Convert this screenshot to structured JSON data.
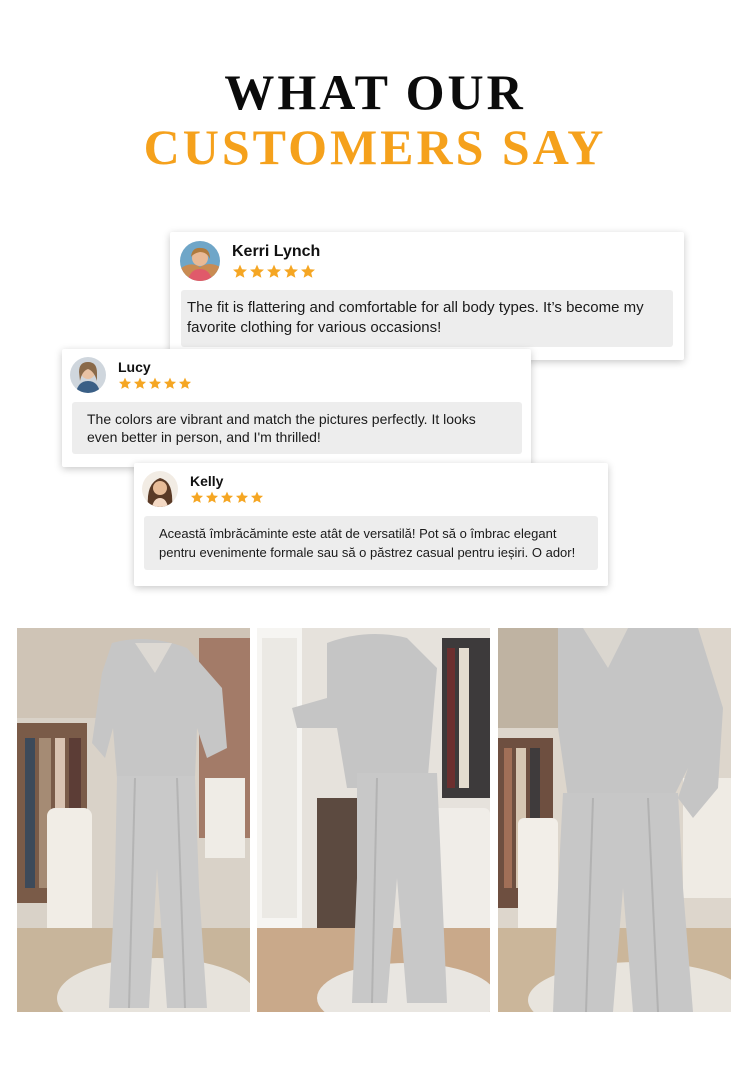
{
  "heading": {
    "line1": "WHAT OUR",
    "line2": "CUSTOMERS SAY",
    "line1_color": "#0b0b0b",
    "accent_color": "#f5a11c"
  },
  "reviews": [
    {
      "name": "Kerri Lynch",
      "rating": 5,
      "text": "The fit is flattering and comfortable for all body types. It’s become my favorite clothing for various occasions!",
      "avatar_icon": "customer-avatar"
    },
    {
      "name": "Lucy",
      "rating": 5,
      "text": "The colors are vibrant and match the pictures perfectly. It looks even better in person, and I'm thrilled!",
      "avatar_icon": "customer-avatar"
    },
    {
      "name": "Kelly",
      "rating": 5,
      "text": "Această îmbrăcăminte este atât de versatilă! Pot să o îmbrac elegant pentru evenimente formale sau să o păstrez casual pentru ieșiri. O ador!",
      "avatar_icon": "customer-avatar"
    }
  ],
  "star_color": "#f5a623",
  "photos": [
    {
      "subject": "woman in grey v-neck sweatshirt and wide-leg sweatpants, front view"
    },
    {
      "subject": "woman in grey v-neck sweatshirt and wide-leg sweatpants, side view"
    },
    {
      "subject": "woman in grey sweatshirt and sweatpants, close-up of pants"
    }
  ],
  "outfit_color": "#c9c9c9"
}
